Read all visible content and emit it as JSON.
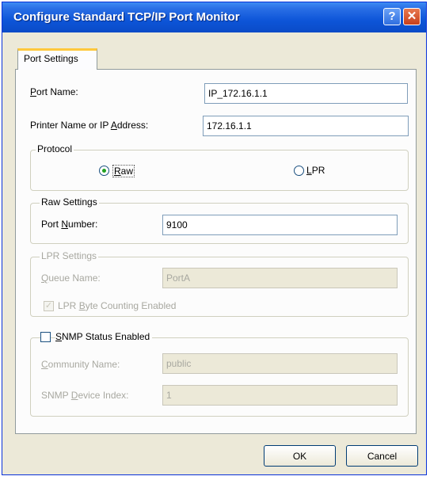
{
  "window": {
    "title": "Configure Standard TCP/IP Port Monitor",
    "help_symbol": "?",
    "close_symbol": "✕"
  },
  "tab": {
    "label": "Port Settings"
  },
  "port_name": {
    "label": "Port Name:",
    "value": "IP_172.16.1.1"
  },
  "printer_address": {
    "label": "Printer Name or IP Address:",
    "value": "172.16.1.1"
  },
  "protocol": {
    "title": "Protocol",
    "raw_label": "Raw",
    "lpr_label": "LPR",
    "selected": "Raw"
  },
  "raw_settings": {
    "title": "Raw Settings",
    "port_number_label": "Port Number:",
    "port_number_value": "9100"
  },
  "lpr_settings": {
    "title": "LPR Settings",
    "queue_name_label": "Queue Name:",
    "queue_name_value": "PortA",
    "byte_counting_label": "LPR Byte Counting Enabled",
    "byte_counting_checked": true
  },
  "snmp": {
    "label": "SNMP Status Enabled",
    "checked": false,
    "community_name_label": "Community Name:",
    "community_name_value": "public",
    "device_index_label": "SNMP Device Index:",
    "device_index_value": "1"
  },
  "buttons": {
    "ok": "OK",
    "cancel": "Cancel"
  }
}
